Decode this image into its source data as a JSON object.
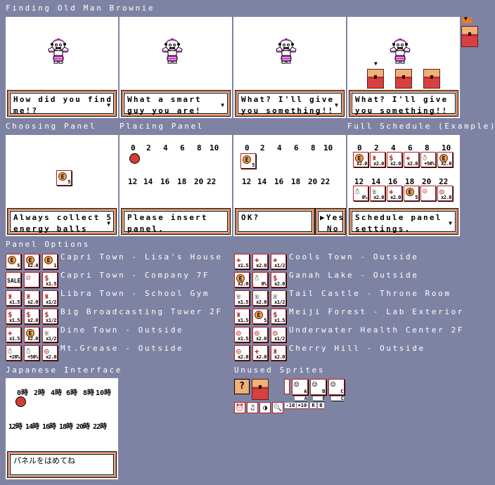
{
  "sections": {
    "finding": "Finding Old Man Brownie",
    "choosing": "Choosing Panel",
    "placing": "Placing Panel",
    "full_schedule": "Full Schedule (Example)",
    "panel_options": "Panel Options",
    "japanese": "Japanese Interface",
    "unused": "Unused Sprites"
  },
  "finding_dialogs": [
    {
      "l1": "How did you find",
      "l2": "me!?",
      "arrow": "▼"
    },
    {
      "l1": "What a smart",
      "l2": "guy you are!",
      "arrow": "▼"
    },
    {
      "l1": "What? I'll give",
      "l2": "you something!!",
      "arrow": "▼"
    },
    {
      "l1": "What? I'll give",
      "l2": "you something!!",
      "arrow": ""
    }
  ],
  "choosing_dialog": {
    "l1": "Always collect 5",
    "l2": "energy balls",
    "arrow": "▼"
  },
  "placing_dialog": {
    "l1": "Please insert",
    "l2": "panel."
  },
  "confirm_dialog": {
    "l1": "OK?",
    "yes": "▶Yes",
    "no": "No"
  },
  "schedule_dialog": {
    "l1": "Schedule panel",
    "l2": "settings.",
    "arrow": "▼"
  },
  "hours_top": [
    "0",
    "2",
    "4",
    "6",
    "8",
    "10"
  ],
  "hours_bottom": [
    "12",
    "14",
    "16",
    "18",
    "20",
    "22"
  ],
  "japanese_hours_top": [
    "0時",
    "2時",
    "4時",
    "6時",
    "8時",
    "10時"
  ],
  "japanese_hours_bottom": [
    "12時",
    "14時",
    "16時",
    "18時",
    "20時",
    "22時"
  ],
  "japanese_dialog": "パネルをはめてね",
  "choosing_panel": {
    "icon": "E",
    "label": "5"
  },
  "placed_panel": {
    "icon": "E",
    "label": "5"
  },
  "schedule_panels_top": [
    {
      "icon": "E",
      "label": "x2.0"
    },
    {
      "icon": "♜",
      "label": "x2.0"
    },
    {
      "icon": "$",
      "label": "x2.0"
    },
    {
      "icon": "✚",
      "label": "x2.0"
    },
    {
      "icon": "☃",
      "label": "+50%"
    },
    {
      "icon": "E",
      "label": "x2.0"
    }
  ],
  "schedule_panels_bottom": [
    {
      "icon": "☃",
      "label": "0%"
    },
    {
      "icon": "☏",
      "label": "x2.0"
    },
    {
      "icon": "✚",
      "label": "x2.0"
    },
    {
      "icon": "E",
      "label": "5"
    },
    {
      "icon": "☹",
      "label": ""
    },
    {
      "icon": "◎",
      "label": "x2.0"
    }
  ],
  "options_left": [
    {
      "location": "Capri Town - Lisa's House",
      "panels": [
        {
          "icon": "E",
          "label": "5"
        },
        {
          "icon": "E",
          "label": "x2.0"
        },
        {
          "icon": "E",
          "label": "1"
        }
      ]
    },
    {
      "location": "Capri Town - Company 7F",
      "panels": [
        {
          "icon": "SALE",
          "label": ""
        },
        {
          "icon": "☹",
          "label": ""
        },
        {
          "icon": "$",
          "label": "x1.5"
        }
      ]
    },
    {
      "location": "Libra Town - School Gym",
      "panels": [
        {
          "icon": "♜",
          "label": "x1.5"
        },
        {
          "icon": "♜",
          "label": "x2.0"
        },
        {
          "icon": "♜",
          "label": "x1/2"
        }
      ]
    },
    {
      "location": "Big Broadcasting Tower 2F",
      "panels": [
        {
          "icon": "$",
          "label": "x1.5"
        },
        {
          "icon": "$",
          "label": "x2.0"
        },
        {
          "icon": "$",
          "label": "x1/2"
        }
      ]
    },
    {
      "location": "Dine Town - Outside",
      "panels": [
        {
          "icon": "✚",
          "label": "x1.5"
        },
        {
          "icon": "E",
          "label": "x2.0"
        },
        {
          "icon": "☏",
          "label": "x1/2"
        }
      ]
    },
    {
      "location": "Mt.Grease - Outside",
      "panels": [
        {
          "icon": "☃",
          "label": "+20%"
        },
        {
          "icon": "☃",
          "label": "+50%"
        },
        {
          "icon": "◎",
          "label": "x2.0"
        }
      ]
    }
  ],
  "options_right": [
    {
      "location": "Cools Town - Outside",
      "panels": [
        {
          "icon": "✚",
          "label": "x1.5"
        },
        {
          "icon": "✚",
          "label": "x2.0"
        },
        {
          "icon": "✚",
          "label": "x1/2"
        }
      ]
    },
    {
      "location": "Ganah Lake - Outside",
      "panels": [
        {
          "icon": "E",
          "label": "x2.0"
        },
        {
          "icon": "☃",
          "label": "0%"
        },
        {
          "icon": "$",
          "label": "x2.0"
        }
      ]
    },
    {
      "location": "Tail Castle - Throne Room",
      "panels": [
        {
          "icon": "☏",
          "label": "x1.5"
        },
        {
          "icon": "☏",
          "label": "x2.0"
        },
        {
          "icon": "☏",
          "label": "x1/2"
        }
      ]
    },
    {
      "location": "Meiji Forest - Lab Exterior",
      "panels": [
        {
          "icon": "♜",
          "label": "x1.5"
        },
        {
          "icon": "E",
          "label": "5"
        },
        {
          "icon": "$",
          "label": "x1.5"
        }
      ]
    },
    {
      "location": "Underwater Health Center 2F",
      "panels": [
        {
          "icon": "◎",
          "label": "x1.5"
        },
        {
          "icon": "◎",
          "label": "x2.0"
        },
        {
          "icon": "◎",
          "label": "x1/2"
        }
      ]
    },
    {
      "location": "Cherry Hill - Outside",
      "panels": [
        {
          "icon": "◎",
          "label": "x2.0"
        },
        {
          "icon": "✚",
          "label": "x2.0"
        },
        {
          "icon": "♜",
          "label": "x2.0"
        }
      ]
    }
  ],
  "unused": {
    "question": "?",
    "character_labels": [
      "A",
      "B",
      "C"
    ],
    "tags": [
      "A",
      "B",
      "C"
    ],
    "small_icons": [
      "⏰",
      "♫",
      "◑",
      "🔍"
    ],
    "small_tags": [
      "-10",
      "+10",
      "R",
      "B"
    ]
  },
  "cursor_arrow": "▼"
}
